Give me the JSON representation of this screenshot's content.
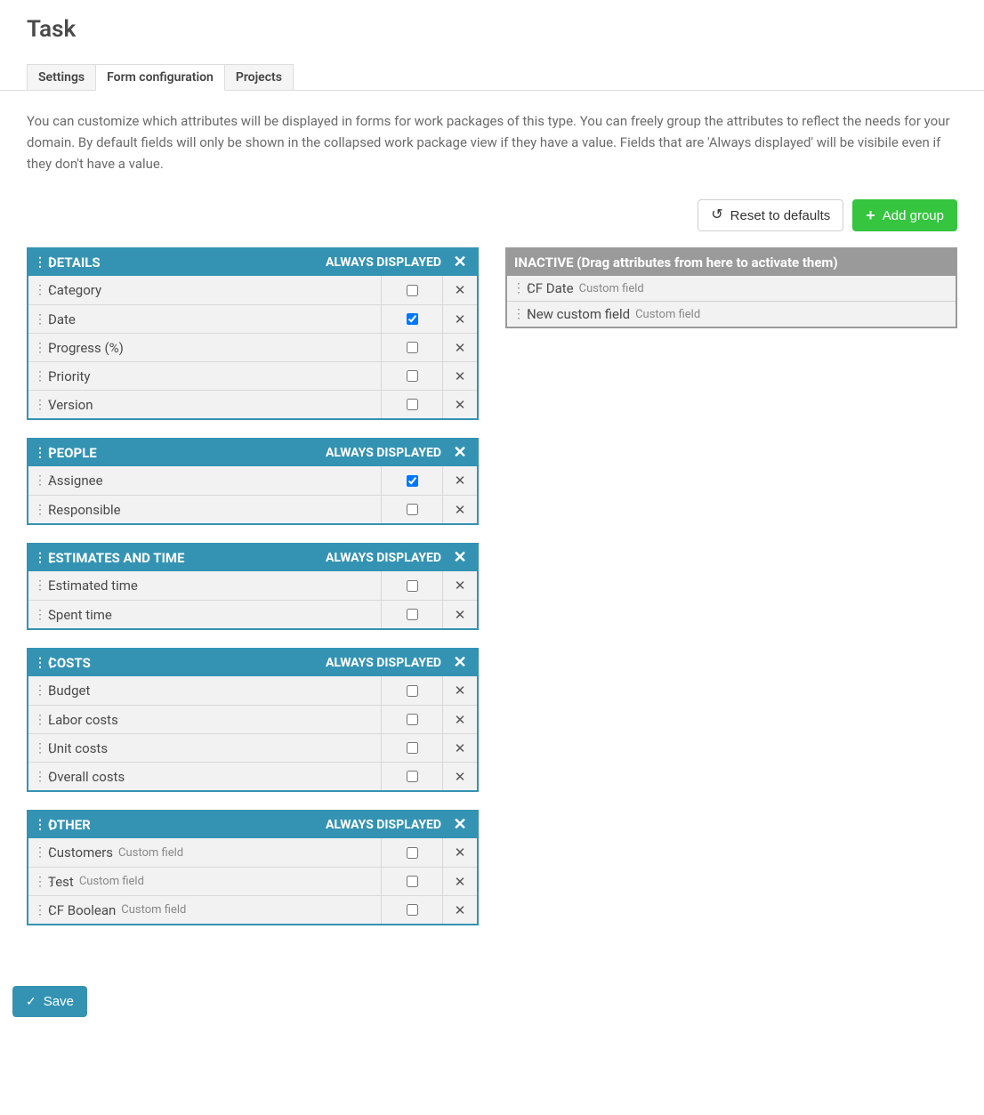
{
  "title": "Task",
  "tabs": [
    {
      "label": "Settings",
      "active": false
    },
    {
      "label": "Form configuration",
      "active": true
    },
    {
      "label": "Projects",
      "active": false
    }
  ],
  "description": "You can customize which attributes will be displayed in forms for work packages of this type. You can freely group the attributes to reflect the needs for your domain. By default fields will only be shown in the collapsed work package view if they have a value. Fields that are 'Always displayed' will be visibile even if they don't have a value.",
  "actions": {
    "reset_label": "Reset to defaults",
    "add_group_label": "Add group",
    "save_label": "Save"
  },
  "column_header_always": "ALWAYS DISPLAYED",
  "groups": [
    {
      "name": "DETAILS",
      "attributes": [
        {
          "name": "Category",
          "always": false,
          "subtype": ""
        },
        {
          "name": "Date",
          "always": true,
          "subtype": ""
        },
        {
          "name": "Progress (%)",
          "always": false,
          "subtype": ""
        },
        {
          "name": "Priority",
          "always": false,
          "subtype": ""
        },
        {
          "name": "Version",
          "always": false,
          "subtype": ""
        }
      ]
    },
    {
      "name": "PEOPLE",
      "attributes": [
        {
          "name": "Assignee",
          "always": true,
          "subtype": ""
        },
        {
          "name": "Responsible",
          "always": false,
          "subtype": ""
        }
      ]
    },
    {
      "name": "ESTIMATES AND TIME",
      "attributes": [
        {
          "name": "Estimated time",
          "always": false,
          "subtype": ""
        },
        {
          "name": "Spent time",
          "always": false,
          "subtype": ""
        }
      ]
    },
    {
      "name": "COSTS",
      "attributes": [
        {
          "name": "Budget",
          "always": false,
          "subtype": ""
        },
        {
          "name": "Labor costs",
          "always": false,
          "subtype": ""
        },
        {
          "name": "Unit costs",
          "always": false,
          "subtype": ""
        },
        {
          "name": "Overall costs",
          "always": false,
          "subtype": ""
        }
      ]
    },
    {
      "name": "OTHER",
      "attributes": [
        {
          "name": "Customers",
          "always": false,
          "subtype": "Custom field"
        },
        {
          "name": "Test",
          "always": false,
          "subtype": "Custom field"
        },
        {
          "name": "CF Boolean",
          "always": false,
          "subtype": "Custom field"
        }
      ]
    }
  ],
  "inactive": {
    "header": "INACTIVE (Drag attributes from here to activate them)",
    "attributes": [
      {
        "name": "CF Date",
        "subtype": "Custom field"
      },
      {
        "name": "New custom field",
        "subtype": "Custom field"
      }
    ]
  }
}
